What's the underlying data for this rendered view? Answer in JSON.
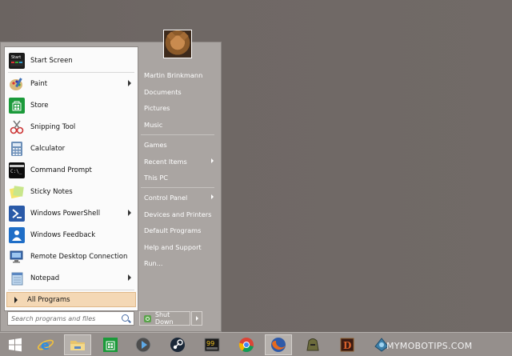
{
  "colors": {
    "desktop": "#6f6865",
    "start_menu_bg": "#aaa5a2",
    "left_pane_bg": "#fbfbfb",
    "all_programs_highlight": "#f4d8b5",
    "taskbar": "#958f8c"
  },
  "start_menu": {
    "programs": [
      {
        "label": "Start Screen",
        "icon": "start-screen-icon",
        "submenu": false
      },
      {
        "label": "Paint",
        "icon": "paint-icon",
        "submenu": true
      },
      {
        "label": "Store",
        "icon": "store-icon",
        "submenu": false
      },
      {
        "label": "Snipping Tool",
        "icon": "snipping-tool-icon",
        "submenu": false
      },
      {
        "label": "Calculator",
        "icon": "calculator-icon",
        "submenu": false
      },
      {
        "label": "Command Prompt",
        "icon": "command-prompt-icon",
        "submenu": false
      },
      {
        "label": "Sticky Notes",
        "icon": "sticky-notes-icon",
        "submenu": false
      },
      {
        "label": "Windows PowerShell",
        "icon": "powershell-icon",
        "submenu": true
      },
      {
        "label": "Windows Feedback",
        "icon": "feedback-icon",
        "submenu": false
      },
      {
        "label": "Remote Desktop Connection",
        "icon": "remote-desktop-icon",
        "submenu": false
      },
      {
        "label": "Notepad",
        "icon": "notepad-icon",
        "submenu": true
      }
    ],
    "all_programs": "All Programs",
    "search_placeholder": "Search programs and files",
    "right_items": [
      {
        "label": "Martin Brinkmann",
        "submenu": false
      },
      {
        "label": "Documents",
        "submenu": false
      },
      {
        "label": "Pictures",
        "submenu": false
      },
      {
        "label": "Music",
        "submenu": false
      },
      {
        "label": "Games",
        "submenu": false
      },
      {
        "label": "Recent Items",
        "submenu": true
      },
      {
        "label": "This PC",
        "submenu": false
      },
      {
        "label": "Control Panel",
        "submenu": true
      },
      {
        "label": "Devices and Printers",
        "submenu": false
      },
      {
        "label": "Default Programs",
        "submenu": false
      },
      {
        "label": "Help and Support",
        "submenu": false
      },
      {
        "label": "Run...",
        "submenu": false
      }
    ],
    "shutdown_label": "Shut Down"
  },
  "taskbar": {
    "items": [
      "start-button-icon",
      "internet-explorer-icon",
      "file-explorer-icon",
      "store-icon",
      "media-player-icon",
      "steam-icon",
      "game-99-icon",
      "chrome-icon",
      "firefox-icon",
      "game-helmet-icon",
      "diablo-icon",
      "game-ship-icon"
    ]
  },
  "watermark": "MYMOBOTIPS.COM"
}
